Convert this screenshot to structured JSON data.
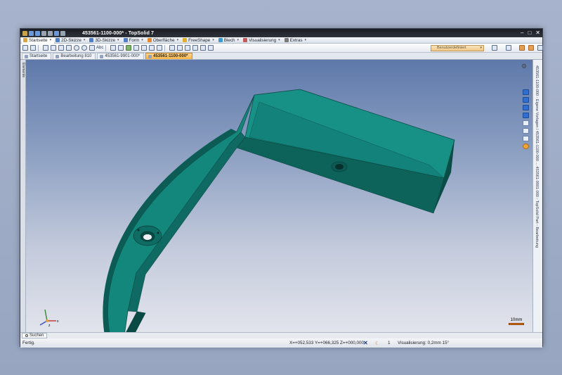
{
  "window": {
    "title": "453561-1100-000* - TopSolid 7"
  },
  "menu": [
    {
      "label": "Startseite",
      "color": "#d9a441"
    },
    {
      "label": "2D-Skizze",
      "color": "#4f7fc6"
    },
    {
      "label": "3D-Skizze",
      "color": "#4f7fc6"
    },
    {
      "label": "Form",
      "color": "#4f7fc6"
    },
    {
      "label": "Oberfläche",
      "color": "#e08a2c"
    },
    {
      "label": "FreeShape",
      "color": "#e0b02c"
    },
    {
      "label": "Blech",
      "color": "#3d9ad1"
    },
    {
      "label": "Visualisierung",
      "color": "#c45959"
    },
    {
      "label": "Extras",
      "color": "#7a7a7a"
    }
  ],
  "toolbar": {
    "text_label": "Abc",
    "combo_value": "Benutzerdefiniert"
  },
  "doc_tabs": [
    {
      "label": "Startseite"
    },
    {
      "label": "Bearbeitung 810"
    },
    {
      "label": "453561-9901-000*"
    },
    {
      "label": "453561-1100-000*"
    }
  ],
  "left_strip": {
    "label": "Elemente"
  },
  "right_panel": {
    "text": "453561-1100-000 - Eigene Vorlagen / 453561-1100-000 ... 453561-9901-000 - TopSolid Part - Bearbeitung"
  },
  "viewport": {
    "scale_label": "10mm",
    "triad_x": "x",
    "triad_z": "z"
  },
  "search": {
    "label": "Suchen"
  },
  "status": {
    "left": "Fertig.",
    "coords": "X=+052,533  Y=+066,325  Z=+000,000",
    "count": "1",
    "visualization": "Visualisierung: 0,2mm 15°"
  },
  "colors": {
    "part_top": "#1a8a80",
    "part_side": "#0e5f58",
    "part_dark": "#0a4842",
    "accent": "#f6b54a"
  },
  "icons": [
    "gear-icon",
    "close-icon",
    "maximize-icon",
    "minimize-icon",
    "search-icon"
  ]
}
